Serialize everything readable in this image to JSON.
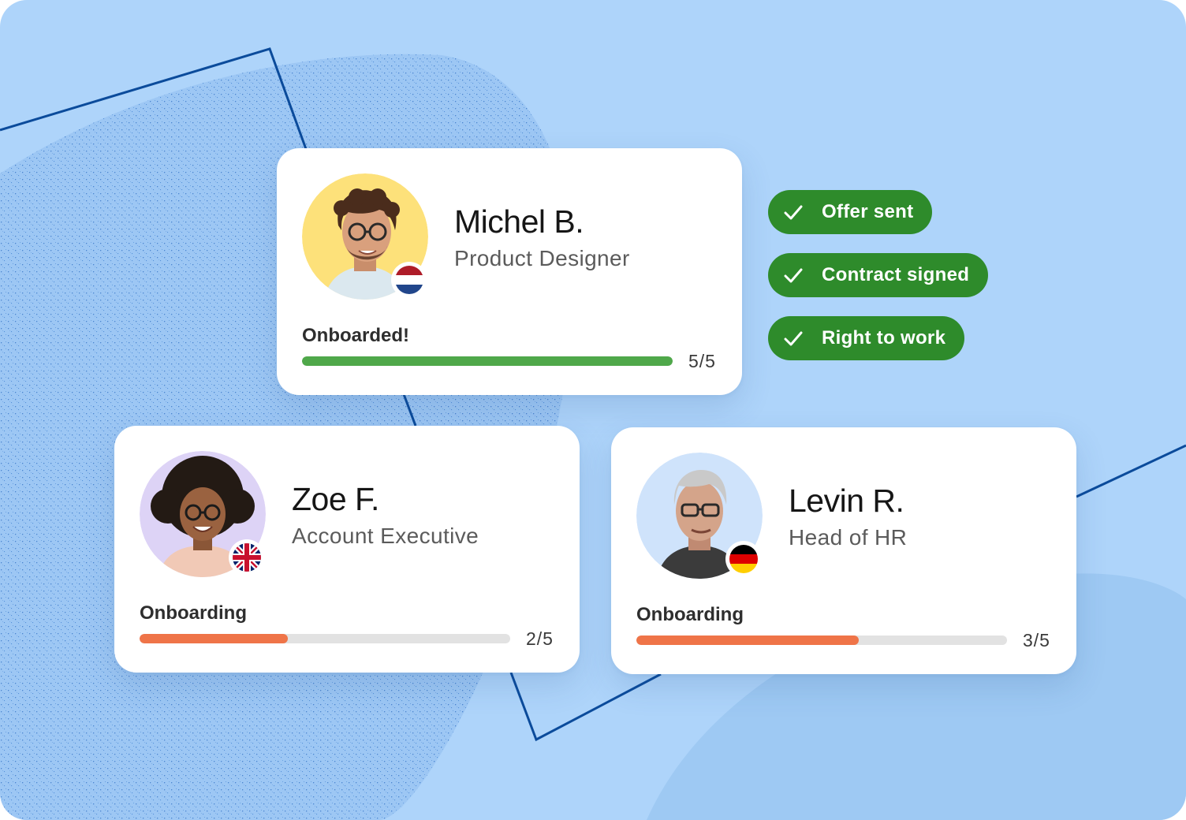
{
  "colors": {
    "background": "#aed4fa",
    "card": "#ffffff",
    "pill_green": "#2e8b2b",
    "progress_complete": "#4fa84a",
    "progress_in_progress": "#ef7448",
    "progress_track": "#e2e2e2",
    "decor_line": "#0b4b9b"
  },
  "employees": [
    {
      "name": "Michel B.",
      "role": "Product Designer",
      "status": "Onboarded!",
      "progress": {
        "done": 5,
        "total": 5,
        "label": "5/5"
      },
      "flag_icon": "netherlands-flag-icon",
      "avatar_bg": "#fde17a"
    },
    {
      "name": "Zoe F.",
      "role": "Account Executive",
      "status": "Onboarding",
      "progress": {
        "done": 2,
        "total": 5,
        "label": "2/5"
      },
      "flag_icon": "uk-flag-icon",
      "avatar_bg": "#ddd3f6"
    },
    {
      "name": "Levin R.",
      "role": "Head of HR",
      "status": "Onboarding",
      "progress": {
        "done": 3,
        "total": 5,
        "label": "3/5"
      },
      "flag_icon": "germany-flag-icon",
      "avatar_bg": "#cfe3fb"
    }
  ],
  "checklist": [
    {
      "label": "Offer sent",
      "icon": "check-icon"
    },
    {
      "label": "Contract signed",
      "icon": "check-icon"
    },
    {
      "label": "Right to work",
      "icon": "check-icon"
    }
  ]
}
